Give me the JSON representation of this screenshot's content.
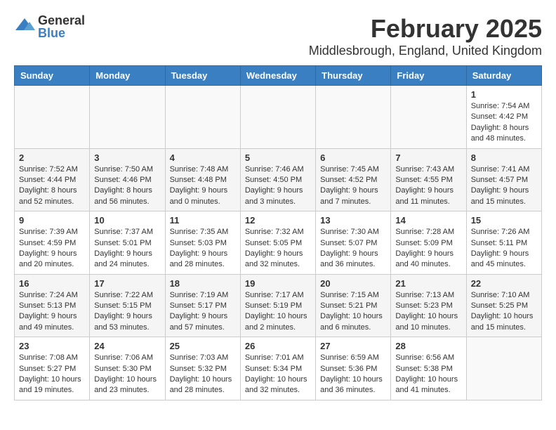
{
  "header": {
    "logo_general": "General",
    "logo_blue": "Blue",
    "month": "February 2025",
    "location": "Middlesbrough, England, United Kingdom"
  },
  "days_of_week": [
    "Sunday",
    "Monday",
    "Tuesday",
    "Wednesday",
    "Thursday",
    "Friday",
    "Saturday"
  ],
  "weeks": [
    [
      {
        "day": "",
        "info": ""
      },
      {
        "day": "",
        "info": ""
      },
      {
        "day": "",
        "info": ""
      },
      {
        "day": "",
        "info": ""
      },
      {
        "day": "",
        "info": ""
      },
      {
        "day": "",
        "info": ""
      },
      {
        "day": "1",
        "info": "Sunrise: 7:54 AM\nSunset: 4:42 PM\nDaylight: 8 hours and 48 minutes."
      }
    ],
    [
      {
        "day": "2",
        "info": "Sunrise: 7:52 AM\nSunset: 4:44 PM\nDaylight: 8 hours and 52 minutes."
      },
      {
        "day": "3",
        "info": "Sunrise: 7:50 AM\nSunset: 4:46 PM\nDaylight: 8 hours and 56 minutes."
      },
      {
        "day": "4",
        "info": "Sunrise: 7:48 AM\nSunset: 4:48 PM\nDaylight: 9 hours and 0 minutes."
      },
      {
        "day": "5",
        "info": "Sunrise: 7:46 AM\nSunset: 4:50 PM\nDaylight: 9 hours and 3 minutes."
      },
      {
        "day": "6",
        "info": "Sunrise: 7:45 AM\nSunset: 4:52 PM\nDaylight: 9 hours and 7 minutes."
      },
      {
        "day": "7",
        "info": "Sunrise: 7:43 AM\nSunset: 4:55 PM\nDaylight: 9 hours and 11 minutes."
      },
      {
        "day": "8",
        "info": "Sunrise: 7:41 AM\nSunset: 4:57 PM\nDaylight: 9 hours and 15 minutes."
      }
    ],
    [
      {
        "day": "9",
        "info": "Sunrise: 7:39 AM\nSunset: 4:59 PM\nDaylight: 9 hours and 20 minutes."
      },
      {
        "day": "10",
        "info": "Sunrise: 7:37 AM\nSunset: 5:01 PM\nDaylight: 9 hours and 24 minutes."
      },
      {
        "day": "11",
        "info": "Sunrise: 7:35 AM\nSunset: 5:03 PM\nDaylight: 9 hours and 28 minutes."
      },
      {
        "day": "12",
        "info": "Sunrise: 7:32 AM\nSunset: 5:05 PM\nDaylight: 9 hours and 32 minutes."
      },
      {
        "day": "13",
        "info": "Sunrise: 7:30 AM\nSunset: 5:07 PM\nDaylight: 9 hours and 36 minutes."
      },
      {
        "day": "14",
        "info": "Sunrise: 7:28 AM\nSunset: 5:09 PM\nDaylight: 9 hours and 40 minutes."
      },
      {
        "day": "15",
        "info": "Sunrise: 7:26 AM\nSunset: 5:11 PM\nDaylight: 9 hours and 45 minutes."
      }
    ],
    [
      {
        "day": "16",
        "info": "Sunrise: 7:24 AM\nSunset: 5:13 PM\nDaylight: 9 hours and 49 minutes."
      },
      {
        "day": "17",
        "info": "Sunrise: 7:22 AM\nSunset: 5:15 PM\nDaylight: 9 hours and 53 minutes."
      },
      {
        "day": "18",
        "info": "Sunrise: 7:19 AM\nSunset: 5:17 PM\nDaylight: 9 hours and 57 minutes."
      },
      {
        "day": "19",
        "info": "Sunrise: 7:17 AM\nSunset: 5:19 PM\nDaylight: 10 hours and 2 minutes."
      },
      {
        "day": "20",
        "info": "Sunrise: 7:15 AM\nSunset: 5:21 PM\nDaylight: 10 hours and 6 minutes."
      },
      {
        "day": "21",
        "info": "Sunrise: 7:13 AM\nSunset: 5:23 PM\nDaylight: 10 hours and 10 minutes."
      },
      {
        "day": "22",
        "info": "Sunrise: 7:10 AM\nSunset: 5:25 PM\nDaylight: 10 hours and 15 minutes."
      }
    ],
    [
      {
        "day": "23",
        "info": "Sunrise: 7:08 AM\nSunset: 5:27 PM\nDaylight: 10 hours and 19 minutes."
      },
      {
        "day": "24",
        "info": "Sunrise: 7:06 AM\nSunset: 5:30 PM\nDaylight: 10 hours and 23 minutes."
      },
      {
        "day": "25",
        "info": "Sunrise: 7:03 AM\nSunset: 5:32 PM\nDaylight: 10 hours and 28 minutes."
      },
      {
        "day": "26",
        "info": "Sunrise: 7:01 AM\nSunset: 5:34 PM\nDaylight: 10 hours and 32 minutes."
      },
      {
        "day": "27",
        "info": "Sunrise: 6:59 AM\nSunset: 5:36 PM\nDaylight: 10 hours and 36 minutes."
      },
      {
        "day": "28",
        "info": "Sunrise: 6:56 AM\nSunset: 5:38 PM\nDaylight: 10 hours and 41 minutes."
      },
      {
        "day": "",
        "info": ""
      }
    ]
  ]
}
